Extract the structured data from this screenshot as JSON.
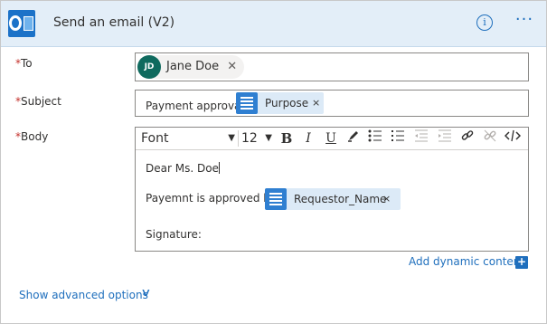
{
  "header": {
    "title": "Send an email (V2)",
    "app_icon": "outlook-icon",
    "info_glyph": "i",
    "more_glyph": "···"
  },
  "fields": {
    "to": {
      "required_mark": "*",
      "label": "To",
      "recipient": {
        "initials": "JD",
        "name": "Jane Doe"
      },
      "remove_glyph": "✕"
    },
    "subject": {
      "required_mark": "*",
      "label": "Subject",
      "text": "Payment approval",
      "token": {
        "label": "Purpose",
        "remove_glyph": "×"
      }
    },
    "body": {
      "required_mark": "*",
      "label": "Body",
      "toolbar": {
        "font": "Font",
        "size": "12",
        "caret": "▼",
        "buttons": [
          "bold",
          "italic",
          "underline",
          "highlight",
          "bulleted-list",
          "numbered-list",
          "decrease-indent",
          "increase-indent",
          "link",
          "unlink",
          "code-view"
        ]
      },
      "lines": {
        "greeting": "Dear Ms. Doe",
        "approval_text": "Payemnt is approved by",
        "signature": "Signature:"
      },
      "token": {
        "label": "Requestor_Name",
        "remove_glyph": "×"
      }
    }
  },
  "actions": {
    "add_dynamic_content": "Add dynamic content",
    "add_dynamic_plus": "+",
    "show_advanced_options": "Show advanced options",
    "chevron": "∨"
  },
  "colors": {
    "header_bg": "#e3eef8",
    "accent": "#1f6fbd",
    "required": "#c4302b",
    "avatar_bg": "#0f6a5e",
    "token_bg": "#dceaf7",
    "token_icon_bg": "#2f7fd1"
  }
}
